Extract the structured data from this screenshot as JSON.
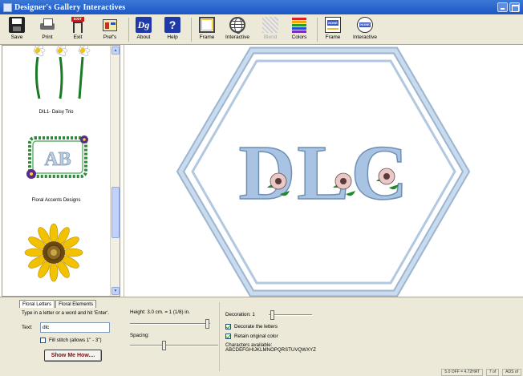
{
  "window": {
    "title": "Designer's Gallery Interactives"
  },
  "toolbar": {
    "buttons": [
      {
        "label": "Save",
        "icon": "save-icon"
      },
      {
        "label": "Print",
        "icon": "printer-icon"
      },
      {
        "label": "Exit",
        "icon": "exit-icon",
        "badge": "EXIT"
      },
      {
        "label": "Pref's",
        "icon": "preferences-icon"
      },
      {
        "label": "About",
        "icon": "about-icon",
        "glyph": "Dg"
      },
      {
        "label": "Help",
        "icon": "help-icon",
        "glyph": "?"
      },
      {
        "label": "Frame",
        "icon": "frame-icon"
      },
      {
        "label": "Interactive",
        "icon": "globe-icon"
      },
      {
        "label": "Blend",
        "icon": "blend-icon",
        "disabled": true
      },
      {
        "label": "Colors",
        "icon": "colors-icon"
      },
      {
        "label": "Frame",
        "icon": "monogram-frame-icon",
        "badge": "NONE"
      },
      {
        "label": "Interactive",
        "icon": "monogram-interactive-icon",
        "badge": "NONE"
      }
    ],
    "color_bars": [
      "#d82424",
      "#f2a900",
      "#2b9a2b",
      "#1d4ed8",
      "#7a2bb8"
    ]
  },
  "design_list": {
    "items": [
      {
        "label": "DIL1- Daisy Trio"
      },
      {
        "label": "Floral Accents Designs",
        "monogram": "AB"
      },
      {
        "label": ""
      }
    ]
  },
  "canvas": {
    "monogram": "DLC",
    "frame_color": "#b9cfe6",
    "letter_color": "#9fbde0"
  },
  "bottom": {
    "tabs": [
      {
        "label": "Floral Letters",
        "active": true
      },
      {
        "label": "Floral Elements",
        "active": false
      }
    ],
    "prompt": "Type in a letter or a word and hit 'Enter'.",
    "text_label": "Text:",
    "text_value": "dlc",
    "fill_stitch_label": "Fill stitch (allows 1\" - 3\")",
    "show_me_label": "Show Me How....",
    "height_label": "Height: 3.0 cm. = 1 (1/8) in.",
    "spacing_label": "Spacing:",
    "decoration_label": "Decoration: 1",
    "decorate_label": "Decorate the letters",
    "retain_label": "Retain original color",
    "chars_title": "Characters available:",
    "chars_value": "ABCDEFGHIJKLMNOPQRSTUVQWXYZ",
    "status": [
      "5.0 OFF = 4.72HAT",
      "7 of",
      "ADS of"
    ]
  }
}
